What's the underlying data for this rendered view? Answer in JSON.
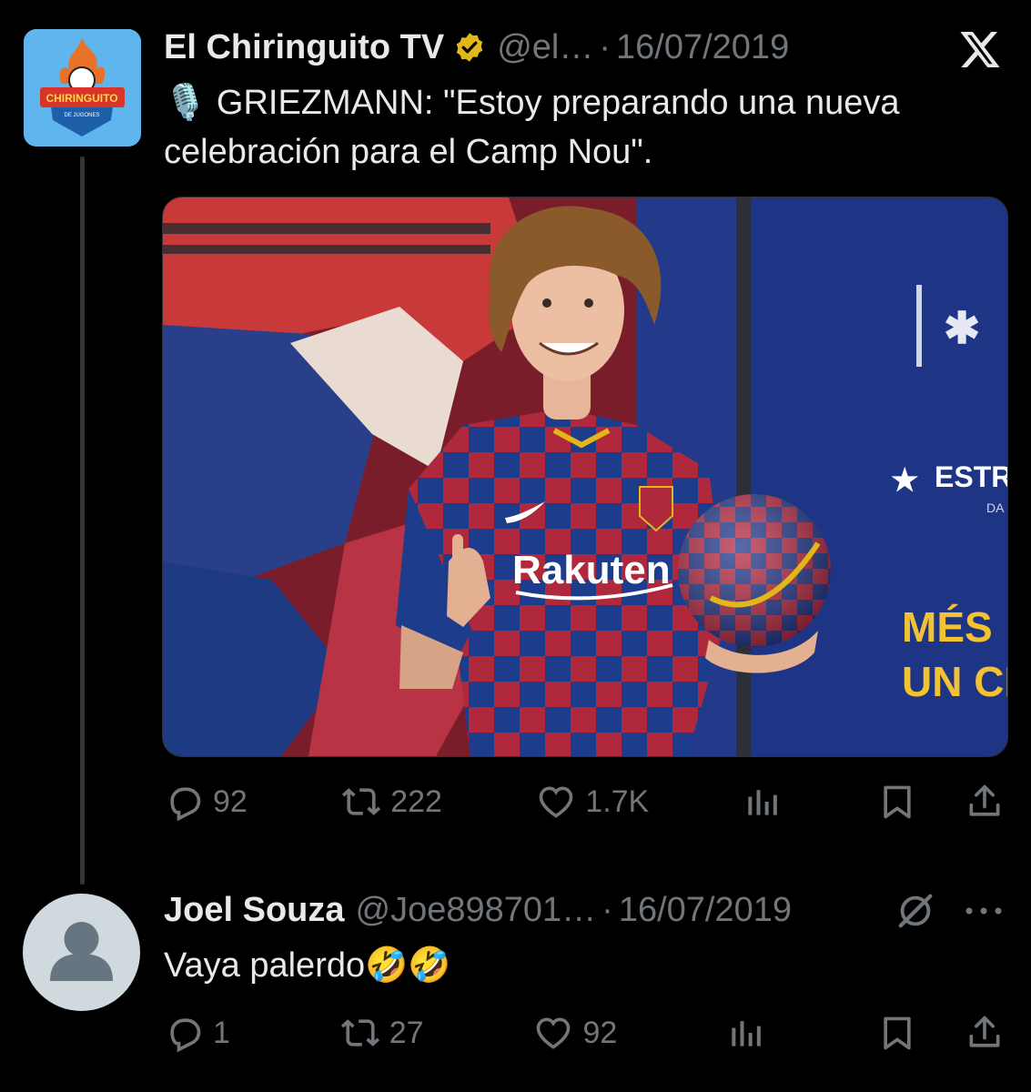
{
  "tweet": {
    "author_name": "El Chiringuito TV",
    "author_handle": "@el…",
    "separator": "·",
    "date": "16/07/2019",
    "avatar_label": "CHIRINGUITO",
    "avatar_sublabel": "DE JUGONES",
    "mic_emoji": "🎙️",
    "text": "GRIEZMANN: \"Estoy preparando una nueva celebración para el Camp Nou\".",
    "image_texts": {
      "sponsor": "Rakuten",
      "banner_brand": "ESTR",
      "banner_sub": "DA",
      "banner_line1": "MÉS",
      "banner_line2": "UN CI"
    },
    "stats": {
      "replies": "92",
      "reposts": "222",
      "likes": "1.7K"
    }
  },
  "reply": {
    "author_name": "Joel Souza",
    "author_handle": "@Joe898701…",
    "separator": "·",
    "date": "16/07/2019",
    "text": "Vaya palerdo🤣🤣",
    "stats": {
      "replies": "1",
      "reposts": "27",
      "likes": "92"
    }
  },
  "colors": {
    "background": "#000000",
    "text_primary": "#e7e9ea",
    "text_secondary": "#71767b",
    "verified_gold": "#e2b719"
  },
  "icons": {
    "close": "x-logo-icon",
    "verified": "verified-badge-icon",
    "reply": "reply-icon",
    "repost": "repost-icon",
    "like": "heart-icon",
    "views": "views-chart-icon",
    "bookmark": "bookmark-icon",
    "share": "share-icon",
    "more": "more-icon",
    "grok": "grok-icon"
  }
}
